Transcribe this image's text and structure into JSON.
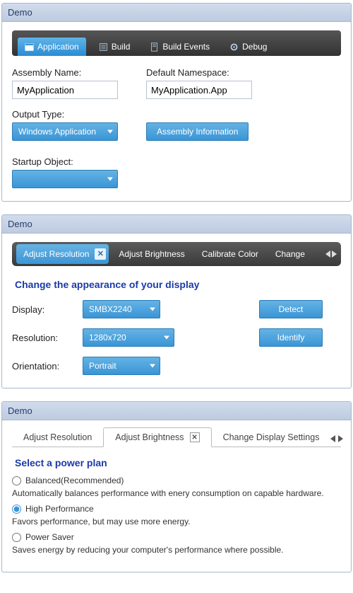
{
  "colors": {
    "accent": "#3a95d6",
    "panelHeader": "#c7d4e8",
    "title": "#1a3aa8"
  },
  "panel1": {
    "title": "Demo",
    "tabs": [
      {
        "label": "Application",
        "icon": "window-icon",
        "active": true
      },
      {
        "label": "Build",
        "icon": "list-icon",
        "active": false
      },
      {
        "label": "Build Events",
        "icon": "doc-icon",
        "active": false
      },
      {
        "label": "Debug",
        "icon": "gear-icon",
        "active": false
      }
    ],
    "assemblyNameLabel": "Assembly Name:",
    "assemblyNameValue": "MyApplication",
    "defaultNamespaceLabel": "Default Namespace:",
    "defaultNamespaceValue": "MyApplication.App",
    "outputTypeLabel": "Output Type:",
    "outputTypeValue": "Windows Application",
    "assemblyInfoButton": "Assembly Information",
    "startupObjectLabel": "Startup Object:",
    "startupObjectValue": ""
  },
  "panel2": {
    "title": "Demo",
    "tabs": [
      {
        "label": "Adjust Resolution",
        "active": true,
        "closable": true
      },
      {
        "label": "Adjust Brightness",
        "active": false
      },
      {
        "label": "Calibrate Color",
        "active": false
      },
      {
        "label": "Change",
        "active": false
      }
    ],
    "heading": "Change the appearance of your display",
    "displayLabel": "Display:",
    "displayValue": "SMBX2240",
    "resolutionLabel": "Resolution:",
    "resolutionValue": "1280x720",
    "orientationLabel": "Orientation:",
    "orientationValue": "Portrait",
    "detectButton": "Detect",
    "identifyButton": "Identify"
  },
  "panel3": {
    "title": "Demo",
    "tabs": [
      {
        "label": "Adjust Resolution",
        "active": false
      },
      {
        "label": "Adjust Brightness",
        "active": true,
        "closable": true
      },
      {
        "label": "Change Display Settings",
        "active": false
      }
    ],
    "heading": "Select a power plan",
    "options": [
      {
        "label": "Balanced(Recommended)",
        "desc": "Automatically balances performance with enery consumption on capable hardware.",
        "checked": false
      },
      {
        "label": "High Performance",
        "desc": "Favors performance, but may use more energy.",
        "checked": true
      },
      {
        "label": "Power Saver",
        "desc": "Saves energy by reducing your computer's performance where possible.",
        "checked": false
      }
    ]
  }
}
